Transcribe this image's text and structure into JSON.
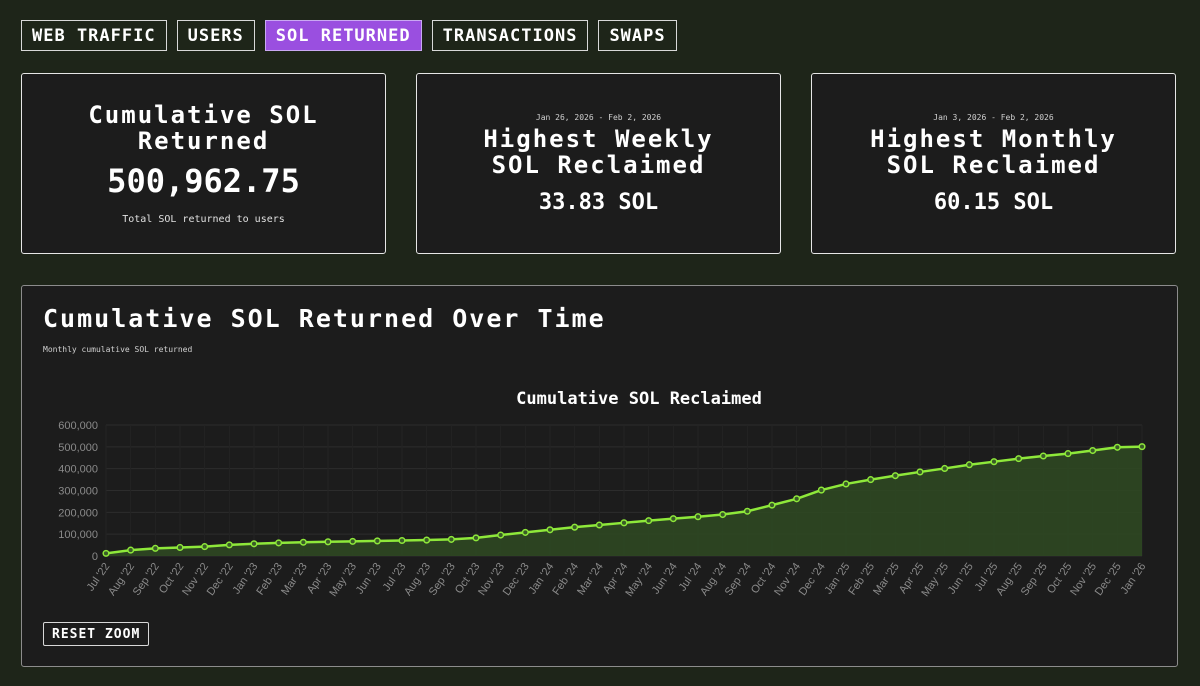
{
  "tabs": [
    {
      "label": "WEB TRAFFIC",
      "active": false
    },
    {
      "label": "USERS",
      "active": false
    },
    {
      "label": "SOL RETURNED",
      "active": true
    },
    {
      "label": "TRANSACTIONS",
      "active": false
    },
    {
      "label": "SWAPS",
      "active": false
    }
  ],
  "cards": {
    "cumulative": {
      "title_line1": "Cumulative SOL",
      "title_line2": "Returned",
      "value": "500,962.75",
      "caption": "Total SOL returned to users"
    },
    "weekly": {
      "range": "Jan 26, 2026 - Feb 2, 2026",
      "title_line1": "Highest Weekly",
      "title_line2": "SOL Reclaimed",
      "value": "33.83 SOL"
    },
    "monthly": {
      "range": "Jan 3, 2026 - Feb 2, 2026",
      "title_line1": "Highest Monthly",
      "title_line2": "SOL Reclaimed",
      "value": "60.15 SOL"
    }
  },
  "panel": {
    "title": "Cumulative SOL Returned Over Time",
    "subtitle": "Monthly cumulative SOL returned",
    "reset_label": "RESET ZOOM"
  },
  "colors": {
    "line": "#8ee83a",
    "fill": "#2f4a22",
    "active_tab": "#9a4fe0",
    "background": "#1e2519",
    "card": "#1c1c1c"
  },
  "chart_data": {
    "type": "area",
    "title": "Cumulative SOL Reclaimed",
    "xlabel": "",
    "ylabel": "",
    "ylim": [
      0,
      600000
    ],
    "yticks": [
      0,
      100000,
      200000,
      300000,
      400000,
      500000,
      600000
    ],
    "ytick_labels": [
      "0",
      "100,000",
      "200,000",
      "300,000",
      "400,000",
      "500,000",
      "600,000"
    ],
    "grid": true,
    "legend": "none",
    "categories": [
      "Jul '22",
      "Aug '22",
      "Sep '22",
      "Oct '22",
      "Nov '22",
      "Dec '22",
      "Jan '23",
      "Feb '23",
      "Mar '23",
      "Apr '23",
      "May '23",
      "Jun '23",
      "Jul '23",
      "Aug '23",
      "Sep '23",
      "Oct '23",
      "Nov '23",
      "Dec '23",
      "Jan '24",
      "Feb '24",
      "Mar '24",
      "Apr '24",
      "May '24",
      "Jun '24",
      "Jul '24",
      "Aug '24",
      "Sep '24",
      "Oct '24",
      "Nov '24",
      "Dec '24",
      "Jan '25",
      "Feb '25",
      "Mar '25",
      "Apr '25",
      "May '25",
      "Jun '25",
      "Jul '25",
      "Aug '25",
      "Sep '25",
      "Oct '25",
      "Nov '25",
      "Dec '25",
      "Jan '26"
    ],
    "series": [
      {
        "values": [
          12000,
          27000,
          35000,
          39000,
          43000,
          51000,
          56000,
          60000,
          63000,
          65000,
          67000,
          69000,
          71000,
          73000,
          76000,
          83000,
          96000,
          108000,
          120000,
          132000,
          142000,
          152000,
          162000,
          171000,
          180000,
          190000,
          205000,
          233000,
          262000,
          302000,
          330000,
          350000,
          368000,
          385000,
          401000,
          418000,
          432000,
          446000,
          458000,
          469000,
          483000,
          498000,
          500962.75
        ]
      }
    ]
  }
}
